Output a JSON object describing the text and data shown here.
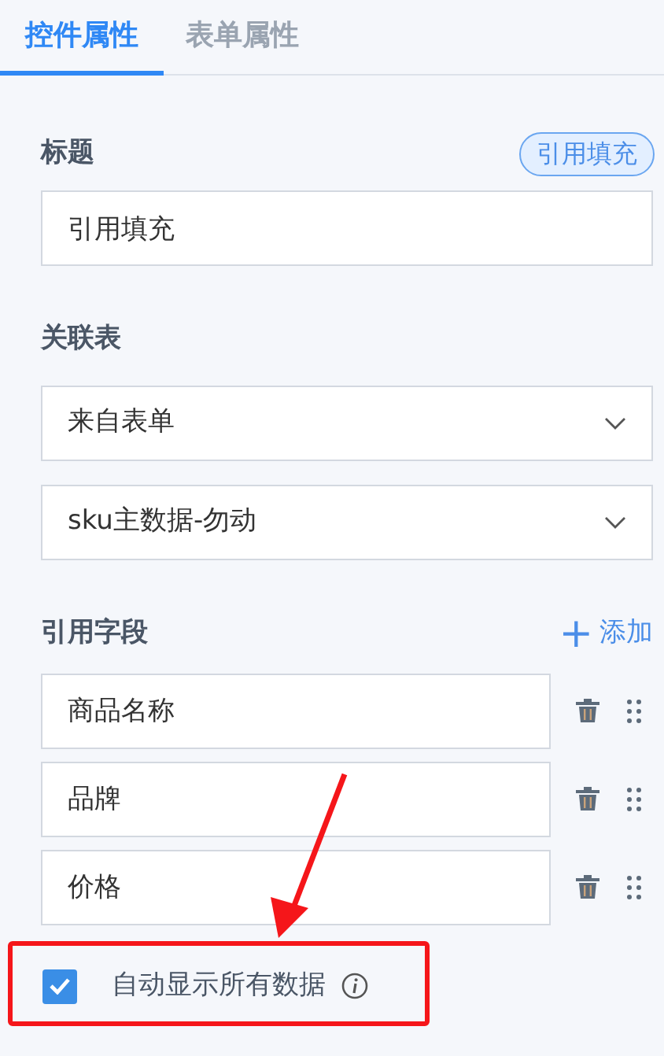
{
  "tabs": [
    {
      "label": "控件属性",
      "selected": true
    },
    {
      "label": "表单属性",
      "selected": false
    }
  ],
  "title_section": {
    "label": "标题",
    "badge": "引用填充",
    "value": "引用填充"
  },
  "related_table": {
    "label": "关联表",
    "selects": [
      "来自表单",
      "sku主数据-勿动"
    ]
  },
  "ref_fields": {
    "label": "引用字段",
    "add_icon": "+",
    "add_label": "添加",
    "fields": [
      "商品名称",
      "品牌",
      "价格"
    ]
  },
  "auto_show_all": {
    "label": "自动显示所有数据",
    "checked": true
  }
}
